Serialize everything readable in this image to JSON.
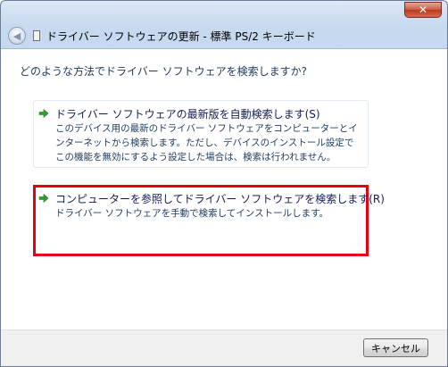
{
  "window": {
    "title": "ドライバー ソフトウェアの更新 - 標準 PS/2 キーボード",
    "close_glyph": "✕",
    "back_glyph": "◀"
  },
  "question": "どのような方法でドライバー ソフトウェアを検索しますか?",
  "options": [
    {
      "title": "ドライバー ソフトウェアの最新版を自動検索します(S)",
      "description": "このデバイス用の最新のドライバー ソフトウェアをコンピューターとインターネットから検索します。ただし、デバイスのインストール設定でこの機能を無効にするよう設定した場合は、検索は行われません。",
      "icon": "green-arrow-icon"
    },
    {
      "title": "コンピューターを参照してドライバー ソフトウェアを検索します(R)",
      "description": "ドライバー ソフトウェアを手動で検索してインストールします。",
      "icon": "green-arrow-icon"
    }
  ],
  "footer": {
    "cancel_label": "キャンセル"
  },
  "colors": {
    "highlight_border": "#e60012",
    "arrow_green": "#2e9e2e",
    "link_text": "#151c55"
  }
}
